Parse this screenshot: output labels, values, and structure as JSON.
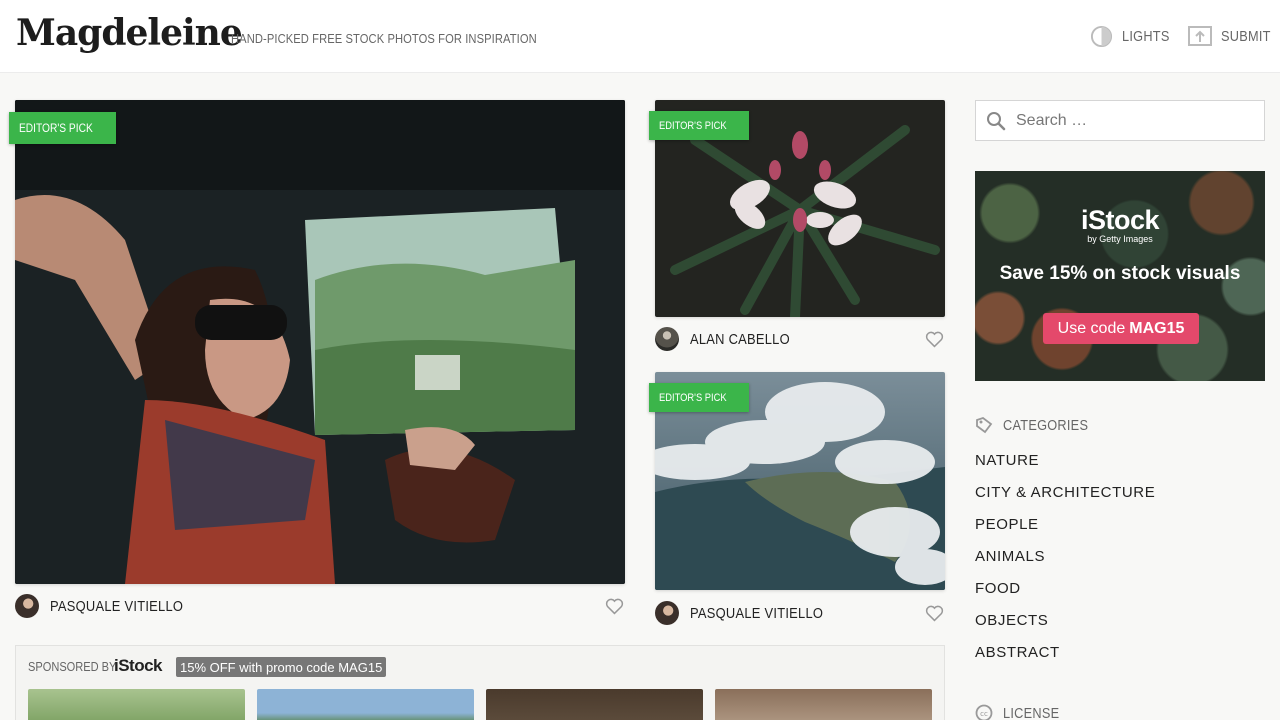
{
  "header": {
    "logo": "Magdeleine",
    "tagline": "HAND-PICKED FREE STOCK PHOTOS FOR INSPIRATION",
    "lights_label": "LIGHTS",
    "submit_label": "SUBMIT"
  },
  "cards": [
    {
      "badge": "EDITOR'S PICK",
      "author": "PASQUALE VITIELLO"
    },
    {
      "badge": "EDITOR'S PICK",
      "author": "ALAN CABELLO"
    },
    {
      "badge": "EDITOR'S PICK",
      "author": "PASQUALE VITIELLO"
    }
  ],
  "search": {
    "placeholder": "Search …"
  },
  "ad": {
    "brand": "iStock",
    "by": "by Getty Images",
    "headline": "Save 15% on stock visuals",
    "cta_prefix": "Use code",
    "cta_code": "MAG15"
  },
  "categories": {
    "title": "CATEGORIES",
    "items": [
      "NATURE",
      "CITY & ARCHITECTURE",
      "PEOPLE",
      "ANIMALS",
      "FOOD",
      "OBJECTS",
      "ABSTRACT"
    ]
  },
  "license": {
    "title": "LICENSE"
  },
  "sponsored": {
    "label": "SPONSORED BY",
    "brand": "iStock",
    "promo": "15% OFF with promo code MAG15"
  },
  "colors": {
    "badge_green": "#3bb54a",
    "cta_pink": "#e4496b"
  }
}
